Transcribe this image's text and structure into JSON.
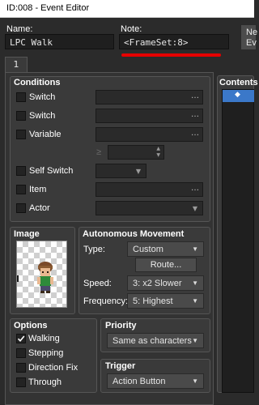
{
  "window": {
    "title": "ID:008 - Event Editor"
  },
  "header": {
    "name_label": "Name:",
    "name_value": "LPC Walk",
    "note_label": "Note:",
    "note_value": "<FrameSet:8>",
    "new_button_lines": [
      "Ne",
      "Ev"
    ]
  },
  "tabs": [
    {
      "label": "1"
    }
  ],
  "conditions": {
    "title": "Conditions",
    "rows": [
      {
        "label": "Switch"
      },
      {
        "label": "Switch"
      },
      {
        "label": "Variable"
      },
      {
        "label": "Self Switch"
      },
      {
        "label": "Item"
      },
      {
        "label": "Actor"
      }
    ],
    "ellipsis": "…",
    "ge_symbol": "≥"
  },
  "image": {
    "title": "Image"
  },
  "autonomous": {
    "title": "Autonomous Movement",
    "type_label": "Type:",
    "type_value": "Custom",
    "route_button": "Route...",
    "speed_label": "Speed:",
    "speed_value": "3: x2 Slower",
    "frequency_label": "Frequency:",
    "frequency_value": "5: Highest"
  },
  "options": {
    "title": "Options",
    "items": [
      {
        "label": "Walking",
        "checked": true
      },
      {
        "label": "Stepping",
        "checked": false
      },
      {
        "label": "Direction Fix",
        "checked": false
      },
      {
        "label": "Through",
        "checked": false
      }
    ]
  },
  "priority": {
    "title": "Priority",
    "value": "Same as characters"
  },
  "trigger": {
    "title": "Trigger",
    "value": "Action Button"
  },
  "contents": {
    "title": "Contents"
  },
  "colors": {
    "accent": "#e60000",
    "selection": "#3b78c9"
  }
}
